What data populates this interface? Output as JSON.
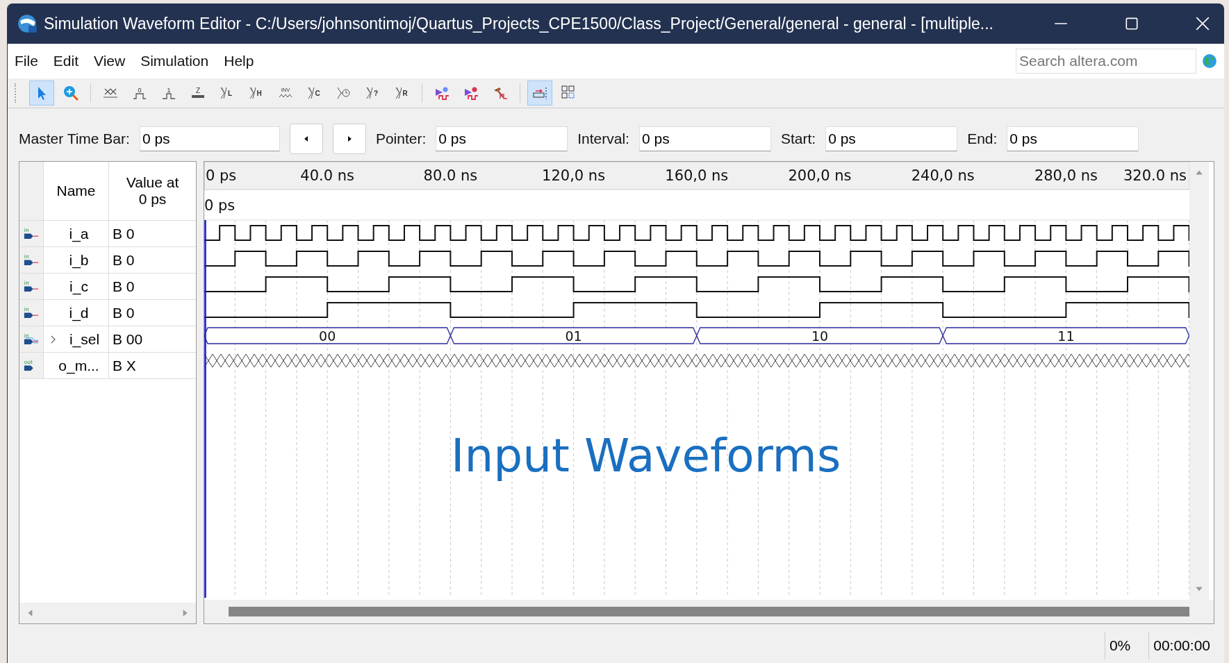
{
  "window": {
    "title": "Simulation Waveform Editor - C:/Users/johnsontimoj/Quartus_Projects_CPE1500/Class_Project/General/general - general - [multiple..."
  },
  "menu": [
    {
      "label": "File"
    },
    {
      "label": "Edit"
    },
    {
      "label": "View"
    },
    {
      "label": "Simulation"
    },
    {
      "label": "Help"
    }
  ],
  "search": {
    "placeholder": "Search altera.com"
  },
  "toolbar": [
    {
      "kind": "pointer",
      "selected": true
    },
    {
      "kind": "zoom",
      "selected": false
    },
    {
      "kind": "sep"
    },
    {
      "kind": "unknown",
      "selected": false
    },
    {
      "kind": "low",
      "glyph": "0",
      "selected": false
    },
    {
      "kind": "high",
      "glyph": "1",
      "selected": false
    },
    {
      "kind": "z",
      "glyph": "Z",
      "selected": false
    },
    {
      "kind": "xletter",
      "glyph": "L",
      "selected": false
    },
    {
      "kind": "xletter",
      "glyph": "H",
      "selected": false
    },
    {
      "kind": "inv",
      "glyph": "INV",
      "selected": false
    },
    {
      "kind": "xletter",
      "glyph": "C",
      "selected": false
    },
    {
      "kind": "clock",
      "selected": false
    },
    {
      "kind": "xletter",
      "glyph": "?",
      "selected": false
    },
    {
      "kind": "xletter",
      "glyph": "R",
      "selected": false
    },
    {
      "kind": "sep"
    },
    {
      "kind": "run",
      "selected": false
    },
    {
      "kind": "run-timing",
      "selected": false
    },
    {
      "kind": "tool",
      "selected": false
    },
    {
      "kind": "sep"
    },
    {
      "kind": "snap",
      "selected": true
    },
    {
      "kind": "grid",
      "selected": false
    }
  ],
  "time_bar": [
    {
      "label": "Master Time Bar:",
      "value": "0 ps",
      "kind": "field-with-nav"
    },
    {
      "label": "Pointer:",
      "value": "0 ps",
      "kind": "field"
    },
    {
      "label": "Interval:",
      "value": "0 ps",
      "kind": "field"
    },
    {
      "label": "Start:",
      "value": "0 ps",
      "kind": "field"
    },
    {
      "label": "End:",
      "value": "0 ps",
      "kind": "field"
    }
  ],
  "signal_table": {
    "columns": [
      "Name",
      "Value at\n0 ps"
    ],
    "rows": [
      {
        "name": "i_a",
        "value": "B 0",
        "pin_label": "in",
        "kind": "clock"
      },
      {
        "name": "i_b",
        "value": "B 0",
        "pin_label": "in",
        "kind": "clock"
      },
      {
        "name": "i_c",
        "value": "B 0",
        "pin_label": "in",
        "kind": "clock"
      },
      {
        "name": "i_d",
        "value": "B 0",
        "pin_label": "in",
        "kind": "clock"
      },
      {
        "name": "i_sel",
        "value": "B 00",
        "pin_label": "in",
        "kind": "bus",
        "expanded": false,
        "segments": [
          "00",
          "01",
          "10",
          "11"
        ]
      },
      {
        "name": "o_m...",
        "value": "B X",
        "pin_label": "out",
        "kind": "unknown"
      }
    ]
  },
  "timeline": {
    "start_label": "0 ps",
    "marker_label": "0 ps",
    "ticks": [
      "40.0 ns",
      "80.0 ns",
      "120,0 ns",
      "160,0 ns",
      "200,0 ns",
      "240,0 ns",
      "280,0 ns",
      "320.0 ns"
    ]
  },
  "annotation": "Input Waveforms",
  "status_bar": {
    "progress": "0%",
    "elapsed": "00:00:00"
  }
}
